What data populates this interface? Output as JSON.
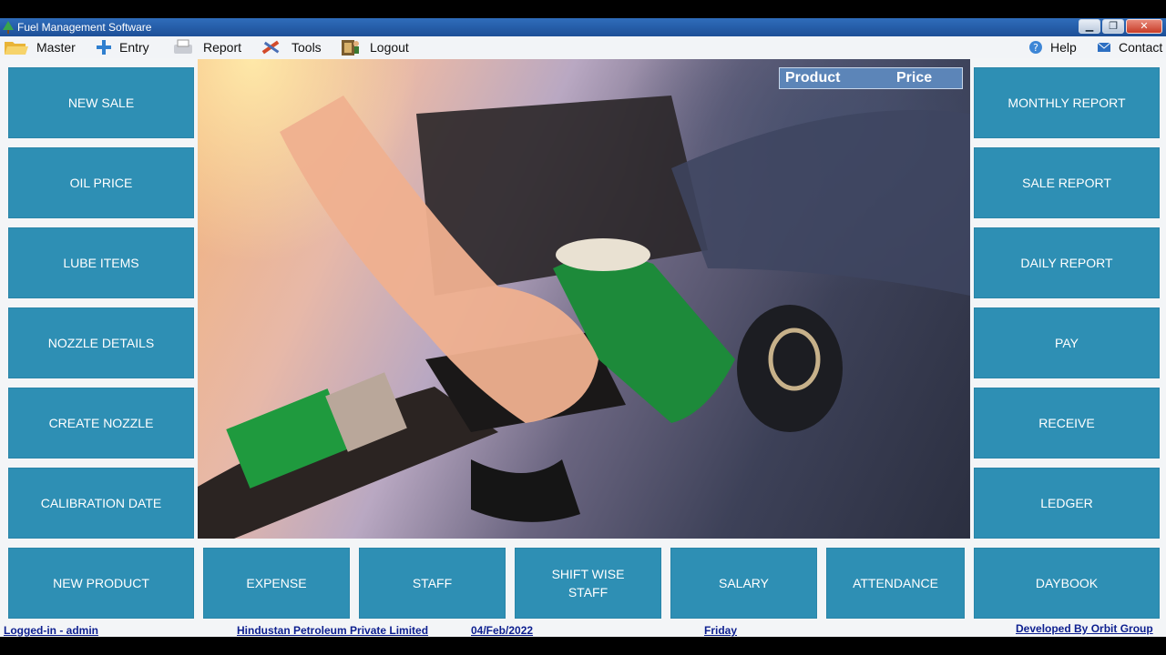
{
  "window": {
    "title": "Fuel Management Software"
  },
  "menu": {
    "left": [
      {
        "label": "Master",
        "icon": "folder-icon"
      },
      {
        "label": "Entry",
        "icon": "plus-icon"
      },
      {
        "label": "Report",
        "icon": "report-icon"
      },
      {
        "label": "Tools",
        "icon": "tools-icon"
      },
      {
        "label": "Logout",
        "icon": "logout-icon"
      }
    ],
    "right": [
      {
        "label": "Help",
        "icon": "help-icon"
      },
      {
        "label": "Contact",
        "icon": "mail-icon"
      }
    ]
  },
  "price_table": {
    "col_product": "Product",
    "col_price": "Price"
  },
  "tiles": {
    "left": [
      "NEW SALE",
      "OIL PRICE",
      "LUBE ITEMS",
      "NOZZLE DETAILS",
      "CREATE NOZZLE",
      "CALIBRATION DATE"
    ],
    "right": [
      "MONTHLY REPORT",
      "SALE REPORT",
      "DAILY REPORT",
      "PAY",
      "RECEIVE",
      "LEDGER"
    ],
    "bottom": [
      "NEW PRODUCT",
      "EXPENSE",
      "STAFF",
      "SHIFT WISE\nSTAFF",
      "SALARY",
      "ATTENDANCE",
      "DAYBOOK"
    ]
  },
  "status": {
    "user": "Logged-in - admin",
    "company": "Hindustan Petroleum Private Limited",
    "date": "04/Feb/2022",
    "day": "Friday",
    "developer": "Developed By Orbit Group"
  },
  "colors": {
    "tile": "#2e8fb4",
    "status_text": "#0d1f8f",
    "price_header": "#5c85b8"
  }
}
